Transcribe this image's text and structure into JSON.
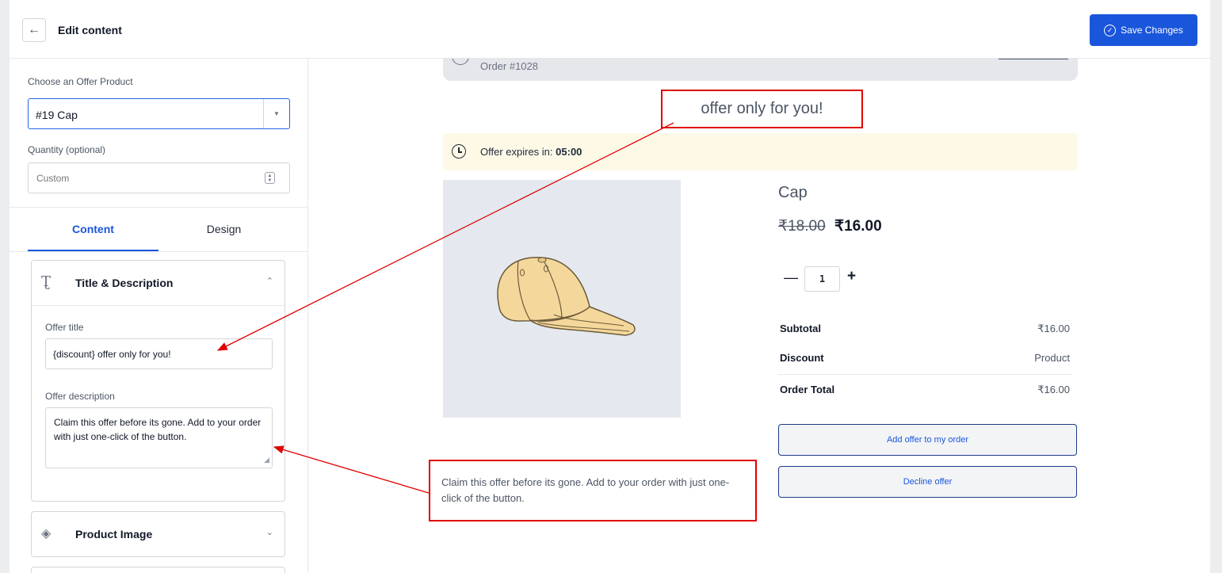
{
  "header": {
    "title": "Edit content",
    "save_label": "Save Changes"
  },
  "sidebar": {
    "offer_product_label": "Choose an Offer Product",
    "offer_product_value": "#19 Cap",
    "quantity_label": "Quantity (optional)",
    "quantity_placeholder": "Custom",
    "tabs": [
      {
        "label": "Content",
        "active": true
      },
      {
        "label": "Design",
        "active": false
      }
    ],
    "title_panel": {
      "title": "Title & Description",
      "offer_title_label": "Offer title",
      "offer_title_value": "{discount} offer only for you!",
      "offer_description_label": "Offer description",
      "offer_description_value": "Claim this offer before its gone. Add to your order with just one-click of the button."
    },
    "product_image_panel": {
      "title": "Product Image"
    }
  },
  "preview": {
    "order_number": "Order #1028",
    "offer_title": "offer only for you!",
    "expiry_label": "Offer expires in:",
    "expiry_time": "05:00",
    "product_name": "Cap",
    "old_price": "₹18.00",
    "new_price": "₹16.00",
    "quantity": "1",
    "summary": [
      {
        "label": "Subtotal",
        "value": "₹16.00"
      },
      {
        "label": "Discount",
        "value": "Product"
      },
      {
        "label": "Order Total",
        "value": "₹16.00"
      }
    ],
    "add_button": "Add offer to my order",
    "decline_button": "Decline offer",
    "description_callout": "Claim this offer before its gone. Add to your order with just one-click of the button."
  },
  "colors": {
    "accent": "#1a56db",
    "annotation": "#e00000",
    "expiry_bg": "#fef9e7",
    "image_bg": "#e5e9ef"
  },
  "icons": [
    "arrow-left-icon",
    "check-circle-icon",
    "chevron-down-icon",
    "text-icon",
    "chevron-up-icon",
    "box-icon",
    "clock-icon",
    "cap-image"
  ]
}
